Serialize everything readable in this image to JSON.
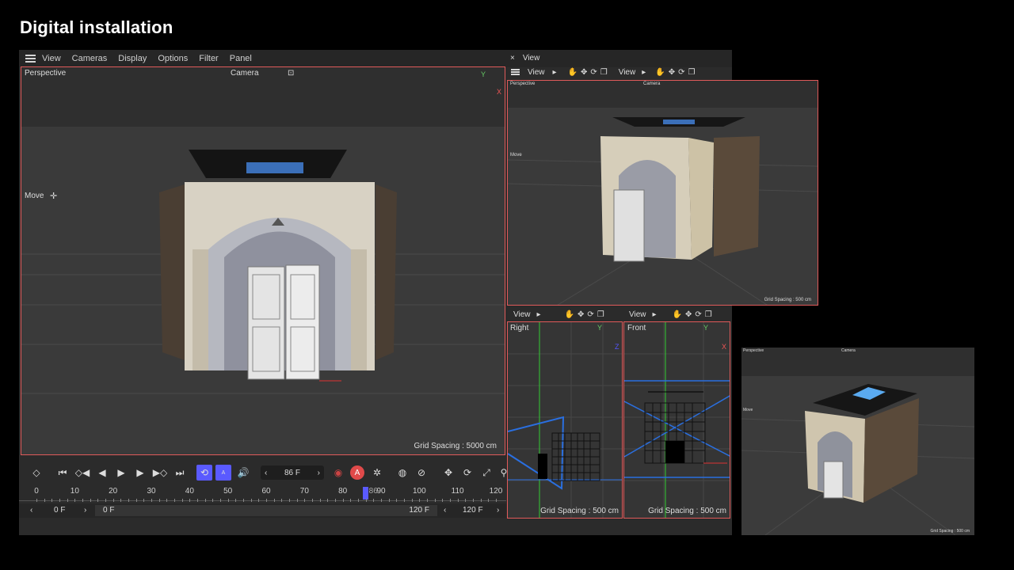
{
  "slide_title": "Digital installation",
  "main_window": {
    "menu": [
      "View",
      "Cameras",
      "Display",
      "Options",
      "Filter",
      "Panel"
    ],
    "viewport": {
      "label": "Perspective",
      "camera": "Camera",
      "tool": "Move",
      "grid_spacing": "Grid Spacing : 5000 cm",
      "axis_y": "Y",
      "axis_x": "X"
    }
  },
  "side_panel": {
    "header_close": "×",
    "header_label": "View",
    "top_view": {
      "left_menu": "View",
      "right_menu": "View",
      "label": "Perspective",
      "camera": "Camera",
      "tool": "Move",
      "grid_spacing": "Grid Spacing : 500 cm"
    },
    "right_view": {
      "menu": "View",
      "label": "Right",
      "grid_spacing": "Grid Spacing : 500 cm",
      "axis_y": "Y",
      "axis_z": "Z"
    },
    "front_view": {
      "menu": "View",
      "label": "Front",
      "grid_spacing": "Grid Spacing : 500 cm",
      "axis_y": "Y",
      "axis_x": "X"
    }
  },
  "timeline": {
    "current_frame": "86 F",
    "playhead_label": "86",
    "ticks": [
      "0",
      "10",
      "20",
      "30",
      "40",
      "50",
      "60",
      "70",
      "80",
      "90",
      "100",
      "110",
      "120"
    ],
    "start_field": "0 F",
    "range_start": "0 F",
    "range_end": "120 F",
    "end_field": "120 F",
    "playhead_frame": 86,
    "max_frame": 120
  },
  "inset_render": {
    "label": "Perspective",
    "camera": "Camera",
    "tool": "Move",
    "grid_spacing": "Grid Spacing : 500 cm"
  },
  "icons": {
    "hand": "hand-icon",
    "move": "move-arrows-icon",
    "rotate": "rotate-icon",
    "maximize": "maximize-icon"
  },
  "colors": {
    "viewport_border": "#e05a5a",
    "timeline_accent": "#5a5aff",
    "blue_line": "#2a6fe0"
  }
}
